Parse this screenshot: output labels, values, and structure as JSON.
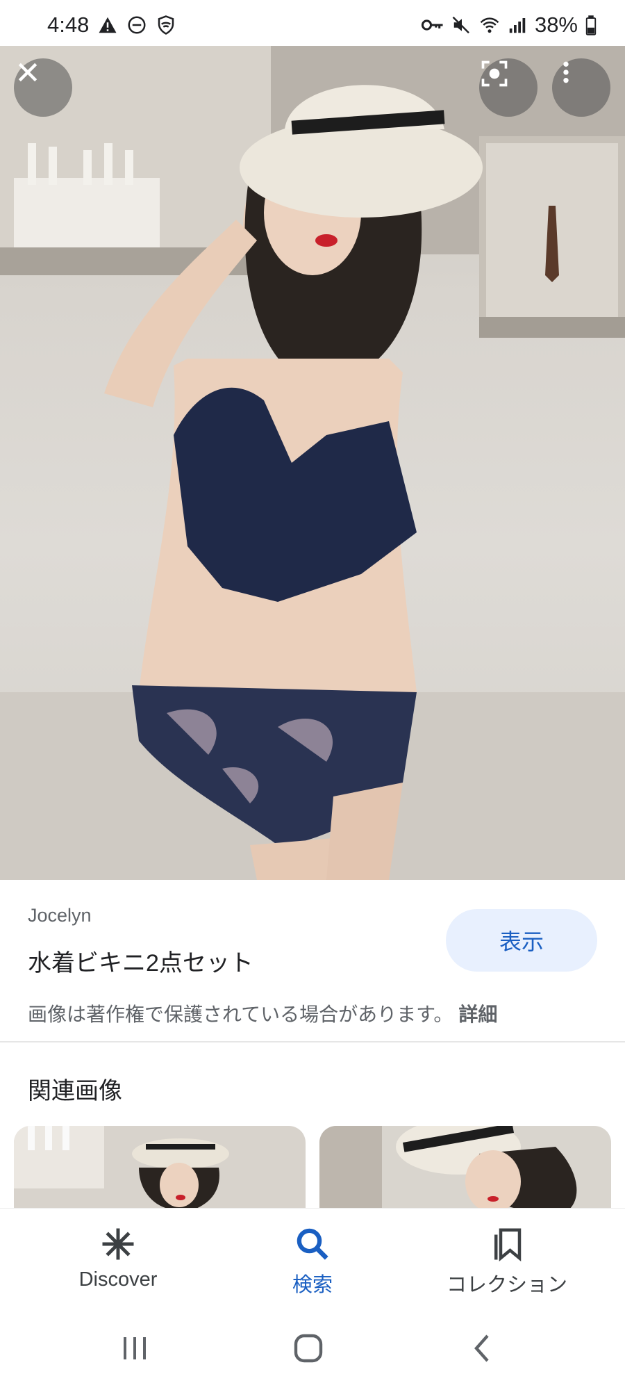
{
  "status_bar": {
    "time": "4:48",
    "battery": "38%",
    "left_icons": [
      "warning-icon",
      "dnd-icon",
      "shield-icon"
    ],
    "right_icons": [
      "vpn-key-icon",
      "mute-icon",
      "wifi-icon",
      "signal-icon",
      "battery-icon"
    ]
  },
  "viewer": {
    "close_icon": "close-icon",
    "lens_icon": "lens-icon",
    "more_icon": "more-vert-icon"
  },
  "result": {
    "source": "Jocelyn",
    "title": "水着ビキニ2点セット",
    "view_label": "表示",
    "copyright_notice": "画像は著作権で保護されている場合があります。",
    "details_label": "詳細"
  },
  "related": {
    "heading": "関連画像"
  },
  "bottom_nav": {
    "items": [
      {
        "label": "Discover",
        "icon": "asterisk-icon",
        "active": false
      },
      {
        "label": "検索",
        "icon": "search-icon",
        "active": true
      },
      {
        "label": "コレクション",
        "icon": "collections-icon",
        "active": false
      }
    ]
  },
  "colors": {
    "accent": "#1a5fc2",
    "button_bg": "#e8f0fe"
  }
}
